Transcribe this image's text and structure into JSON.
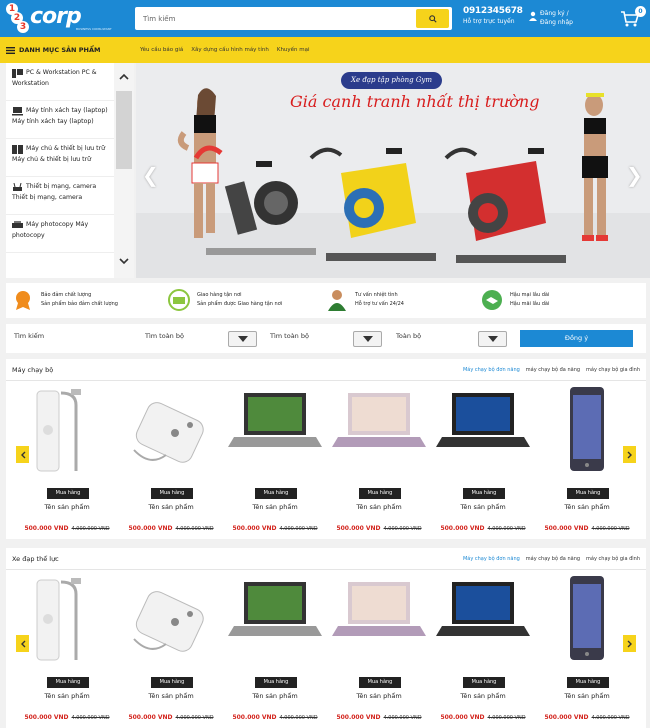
{
  "header": {
    "logo_digits": [
      "1",
      "2",
      "3"
    ],
    "logo_brand": "corp",
    "logo_tagline": "BUSINESS CONSULTANT",
    "search_placeholder": "Tìm kiếm",
    "hotline_number": "0912345678",
    "hotline_label": "Hỗ trợ trực tuyến",
    "register": "Đăng ký /",
    "login": "Đăng nhập",
    "cart_count": "0"
  },
  "nav": {
    "categories_label": "DANH MỤC SẢN PHẨM",
    "links": [
      "Yêu cầu báo giá",
      "Xây dựng cấu hình máy tính",
      "Khuyến mại"
    ]
  },
  "categories": [
    {
      "label": "PC & Workstation PC & Workstation",
      "icon": "pc-icon"
    },
    {
      "label": "Máy tính xách tay (laptop) Máy tính xách tay (laptop)",
      "icon": "laptop-icon"
    },
    {
      "label": "Máy chủ & thiết bị lưu trữ Máy chủ & thiết bị lưu trữ",
      "icon": "server-icon"
    },
    {
      "label": "Thiết bị mạng, camera Thiết bị mạng, camera",
      "icon": "network-icon"
    },
    {
      "label": "Máy photocopy Máy photocopy",
      "icon": "printer-icon"
    }
  ],
  "banner": {
    "pill": "Xe đạp tập phòng Gym",
    "headline": "Giá cạnh tranh nhất thị trường"
  },
  "features": [
    {
      "title": "Bảo đảm chất lượng",
      "desc": "Sản phẩm bảo đảm chất lượng",
      "icon": "quality-icon",
      "color": "#f08c1c"
    },
    {
      "title": "Giao hàng tận nơi",
      "desc": "Sản phẩm được Giao hàng tận nơi",
      "icon": "delivery-icon",
      "color": "#8cc63f"
    },
    {
      "title": "Tư vấn nhiệt tình",
      "desc": "Hỗ trợ tư vấn 24/24",
      "icon": "consultant-icon",
      "color": "#2e7d32"
    },
    {
      "title": "Hậu mại lâu dài",
      "desc": "Hậu mãi lâu dài",
      "icon": "handshake-icon",
      "color": "#4caf50"
    }
  ],
  "filter": {
    "search_label": "Tìm kiếm",
    "select1": "Tìm toàn bộ",
    "select2": "Tìm toàn bộ",
    "select3": "Toàn bộ",
    "button": "Đồng ý"
  },
  "sections": [
    {
      "title": "Máy chạy bộ",
      "tabs": [
        "Máy chạy bộ đơn năng",
        "máy chạy bộ đa năng",
        "máy chạy bộ gia đình"
      ],
      "products": [
        {
          "name": "Tên sản phẩm",
          "price": "500.000 VND",
          "old_price": "4.000.000 VND",
          "buy": "Mua hàng",
          "image": "water-heater-icon"
        },
        {
          "name": "Tên sản phẩm",
          "price": "500.000 VND",
          "old_price": "4.000.000 VND",
          "buy": "Mua hàng",
          "image": "shower-panel-icon"
        },
        {
          "name": "Tên sản phẩm",
          "price": "500.000 VND",
          "old_price": "4.000.000 VND",
          "buy": "Mua hàng",
          "image": "laptop-gray-icon"
        },
        {
          "name": "Tên sản phẩm",
          "price": "500.000 VND",
          "old_price": "4.000.000 VND",
          "buy": "Mua hàng",
          "image": "laptop-purple-icon"
        },
        {
          "name": "Tên sản phẩm",
          "price": "500.000 VND",
          "old_price": "4.000.000 VND",
          "buy": "Mua hàng",
          "image": "laptop-dark-icon"
        },
        {
          "name": "Tên sản phẩm",
          "price": "500.000 VND",
          "old_price": "4.000.000 VND",
          "buy": "Mua hàng",
          "image": "phone-icon"
        }
      ]
    },
    {
      "title": "Xe đạp thể lực",
      "tabs": [
        "Máy chạy bộ đơn năng",
        "máy chạy bộ đa năng",
        "máy chạy bộ gia đình"
      ],
      "products": [
        {
          "name": "Tên sản phẩm",
          "price": "500.000 VND",
          "old_price": "4.000.000 VND",
          "buy": "Mua hàng",
          "image": "water-heater-icon"
        },
        {
          "name": "Tên sản phẩm",
          "price": "500.000 VND",
          "old_price": "4.000.000 VND",
          "buy": "Mua hàng",
          "image": "shower-panel-icon"
        },
        {
          "name": "Tên sản phẩm",
          "price": "500.000 VND",
          "old_price": "4.000.000 VND",
          "buy": "Mua hàng",
          "image": "laptop-gray-icon"
        },
        {
          "name": "Tên sản phẩm",
          "price": "500.000 VND",
          "old_price": "4.000.000 VND",
          "buy": "Mua hàng",
          "image": "laptop-purple-icon"
        },
        {
          "name": "Tên sản phẩm",
          "price": "500.000 VND",
          "old_price": "4.000.000 VND",
          "buy": "Mua hàng",
          "image": "laptop-dark-icon"
        },
        {
          "name": "Tên sản phẩm",
          "price": "500.000 VND",
          "old_price": "4.000.000 VND",
          "buy": "Mua hàng",
          "image": "phone-icon"
        }
      ]
    }
  ],
  "colors": {
    "primary": "#1c89d4",
    "accent": "#f6d31b",
    "price": "#d3241d"
  }
}
